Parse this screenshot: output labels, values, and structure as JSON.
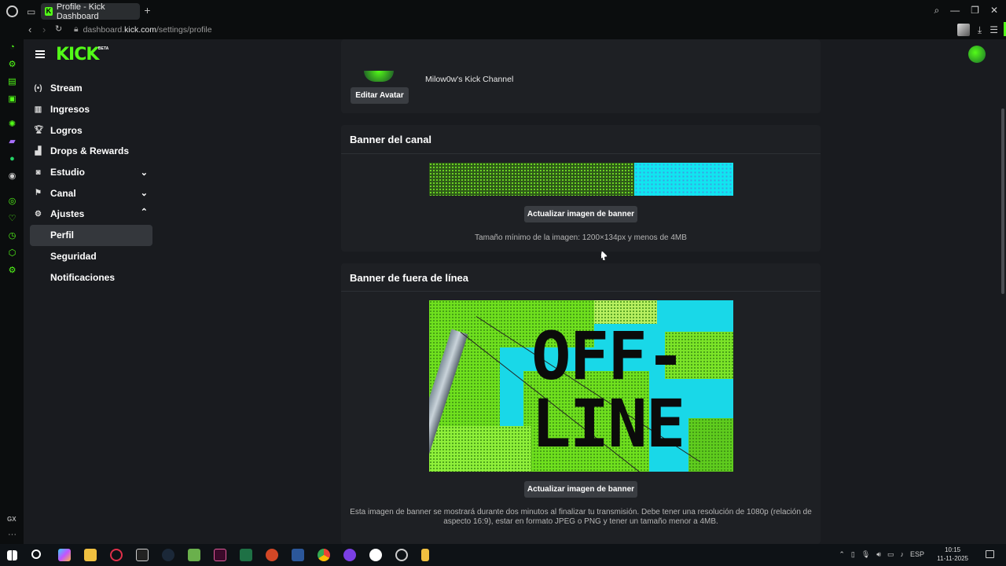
{
  "browser": {
    "tab_title": "Profile - Kick Dashboard",
    "tab_favicon": "K",
    "url_prefix": "dashboard.",
    "url_host": "kick.com",
    "url_path": "/settings/profile",
    "new_tab": "+"
  },
  "app": {
    "logo": "KICK",
    "logo_badge": "BETA"
  },
  "nav": {
    "items": [
      {
        "label": "Stream",
        "icon": "broadcast-icon"
      },
      {
        "label": "Ingresos",
        "icon": "chart-icon"
      },
      {
        "label": "Logros",
        "icon": "trophy-icon"
      },
      {
        "label": "Drops & Rewards",
        "icon": "gift-icon"
      },
      {
        "label": "Estudio",
        "icon": "camera-icon"
      },
      {
        "label": "Canal",
        "icon": "channel-icon"
      },
      {
        "label": "Ajustes",
        "icon": "gear-icon"
      }
    ],
    "sub_items": [
      "Perfil",
      "Seguridad",
      "Notificaciones"
    ],
    "active": "Perfil"
  },
  "profile": {
    "channel_name": "Milow0w's Kick Channel",
    "edit_avatar": "Editar Avatar"
  },
  "banner": {
    "title": "Banner del canal",
    "update_button": "Actualizar imagen de banner",
    "size_note": "Tamaño mínimo de la imagen: 1200×134px y menos de 4MB"
  },
  "offline_banner": {
    "title": "Banner de fuera de línea",
    "image_text_line1": "OFF-",
    "image_text_line2": "LINE",
    "update_button": "Actualizar imagen de banner",
    "note": "Esta imagen de banner se mostrará durante dos minutos al finalizar tu transmisión. Debe tener una resolución de 1080p (relación de aspecto 16:9), estar en formato JPEG o PNG y tener un tamaño menor a 4MB."
  },
  "opera_sidebar": {
    "gx_label": "GX",
    "more": "···"
  },
  "taskbar": {
    "language": "ESP",
    "time": "10:15",
    "date": "11-11-2025"
  },
  "colors": {
    "kick_green": "#53fc18",
    "app_bg": "#191b1f",
    "card_bg": "#1e2024",
    "button_bg": "#3a3d42"
  }
}
